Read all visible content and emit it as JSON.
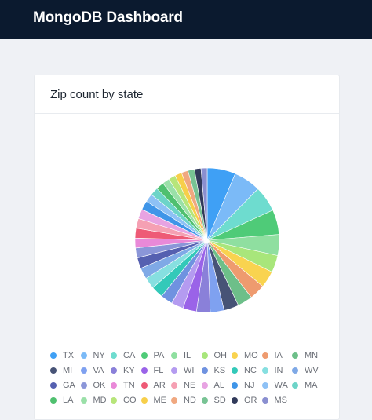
{
  "header": {
    "title": "MongoDB Dashboard"
  },
  "card": {
    "title": "Zip count by state"
  },
  "chart_data": {
    "type": "pie",
    "title": "Zip count by state",
    "legend_position": "bottom",
    "categories": [
      "TX",
      "NY",
      "CA",
      "PA",
      "IL",
      "OH",
      "MO",
      "IA",
      "MN",
      "MI",
      "VA",
      "KY",
      "FL",
      "WI",
      "KS",
      "NC",
      "IN",
      "WV",
      "GA",
      "OK",
      "TN",
      "AR",
      "NE",
      "AL",
      "NJ",
      "WA",
      "MA",
      "LA",
      "MD",
      "CO",
      "ME",
      "ND",
      "SD",
      "OR",
      "MS"
    ],
    "values": [
      1671,
      1595,
      1516,
      1458,
      1237,
      1007,
      994,
      922,
      882,
      876,
      816,
      809,
      804,
      716,
      715,
      705,
      676,
      656,
      635,
      586,
      582,
      578,
      574,
      567,
      540,
      484,
      474,
      464,
      420,
      414,
      410,
      391,
      384,
      384,
      363
    ],
    "colors": [
      "#3fa0f5",
      "#7bbaf7",
      "#6edccf",
      "#4fcb78",
      "#8fdfa0",
      "#a8e67b",
      "#f9d34f",
      "#ee9b6f",
      "#6dbf89",
      "#475376",
      "#7fa1f0",
      "#8a80d9",
      "#9a63e8",
      "#b49bf0",
      "#6f92e0",
      "#33c9b9",
      "#86dfe0",
      "#7fa9e6",
      "#5560b0",
      "#8b96d8",
      "#e989d8",
      "#ee5a76",
      "#f5a0b3",
      "#e7a3e2",
      "#3f95e8",
      "#8ec1f5",
      "#6dd4c8",
      "#4fc06f",
      "#9ae0a8",
      "#b7e57a",
      "#f7cf4a",
      "#f0a880",
      "#78c394",
      "#313a5a",
      "#8a8fd0"
    ]
  }
}
